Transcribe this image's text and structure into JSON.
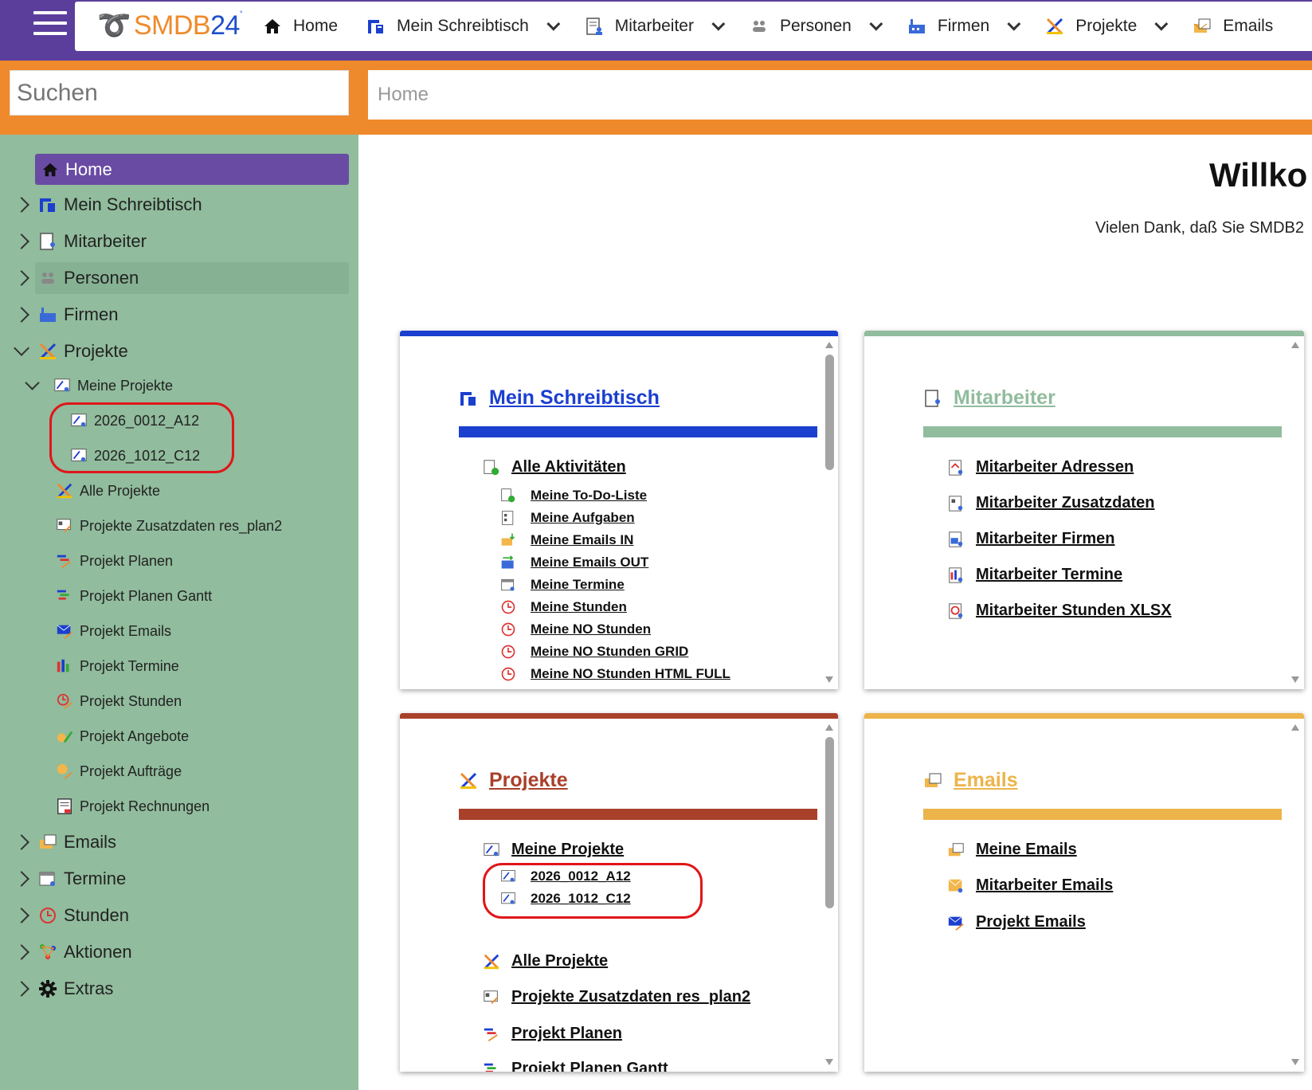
{
  "app": {
    "logo_smdb": "SMDB",
    "logo_num": "24",
    "logo_mark": "°"
  },
  "nav": [
    {
      "label": "Home",
      "icon": "home-icon"
    },
    {
      "label": "Mein Schreibtisch",
      "icon": "desk-icon"
    },
    {
      "label": "Mitarbeiter",
      "icon": "employee-icon"
    },
    {
      "label": "Personen",
      "icon": "persons-icon"
    },
    {
      "label": "Firmen",
      "icon": "factory-icon"
    },
    {
      "label": "Projekte",
      "icon": "project-icon"
    },
    {
      "label": "Emails",
      "icon": "email-icon"
    }
  ],
  "search": {
    "placeholder": "Suchen"
  },
  "breadcrumb": "Home",
  "sidebar": {
    "home": "Home",
    "items": [
      {
        "label": "Mein Schreibtisch"
      },
      {
        "label": "Mitarbeiter"
      },
      {
        "label": "Personen"
      },
      {
        "label": "Firmen"
      },
      {
        "label": "Projekte"
      },
      {
        "label": "Emails"
      },
      {
        "label": "Termine"
      },
      {
        "label": "Stunden"
      },
      {
        "label": "Aktionen"
      },
      {
        "label": "Extras"
      }
    ],
    "projekte_sub": {
      "meine_projekte": "Meine Projekte",
      "projects": [
        "2026_0012_A12",
        "2026_1012_C12"
      ],
      "items": [
        "Alle Projekte",
        "Projekte Zusatzdaten res_plan2",
        "Projekt Planen",
        "Projekt Planen Gantt",
        "Projekt Emails",
        "Projekt Termine",
        "Projekt Stunden",
        "Projekt Angebote",
        "Projekt Aufträge",
        "Projekt Rechnungen"
      ]
    }
  },
  "main": {
    "welcome": "Willko",
    "thanks": "Vielen Dank, daß Sie SMDB2"
  },
  "cards": {
    "schreibtisch": {
      "title": "Mein Schreibtisch",
      "color": "#1b3fcf",
      "section": "Alle Aktivitäten",
      "links": [
        "Meine To-Do-Liste",
        "Meine Aufgaben",
        "Meine Emails IN",
        "Meine Emails OUT",
        "Meine Termine",
        "Meine Stunden",
        "Meine NO Stunden",
        "Meine NO Stunden GRID",
        "Meine NO Stunden HTML FULL"
      ]
    },
    "mitarbeiter": {
      "title": "Mitarbeiter",
      "color": "#91bc9d",
      "links": [
        "Mitarbeiter Adressen",
        "Mitarbeiter Zusatzdaten",
        "Mitarbeiter Firmen",
        "Mitarbeiter Termine",
        "Mitarbeiter Stunden XLSX"
      ]
    },
    "projekte": {
      "title": "Projekte",
      "color": "#a9402a",
      "section": "Meine Projekte",
      "projects": [
        "2026_0012_A12",
        "2026_1012_C12"
      ],
      "links": [
        "Alle Projekte",
        "Projekte Zusatzdaten res_plan2",
        "Projekt Planen",
        "Projekt Planen Gantt"
      ]
    },
    "emails": {
      "title": "Emails",
      "color": "#ecb44a",
      "links": [
        "Meine Emails",
        "Mitarbeiter Emails",
        "Projekt Emails"
      ]
    }
  }
}
